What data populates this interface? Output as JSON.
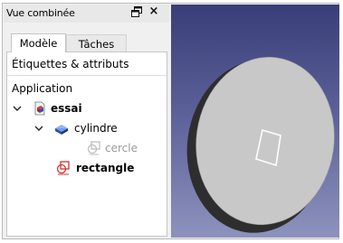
{
  "panel": {
    "title": "Vue combinée",
    "float_icon": "float-window-icon",
    "close_label": "×"
  },
  "tabs": [
    {
      "label": "Modèle",
      "active": true
    },
    {
      "label": "Tâches",
      "active": false
    }
  ],
  "tree": {
    "section_header": "Étiquettes & attributs",
    "group_label": "Application",
    "items": [
      {
        "label": "essai",
        "icon": "document-icon",
        "bold": true,
        "expanded": true
      },
      {
        "label": "cylindre",
        "icon": "cylinder-icon",
        "bold": false,
        "expanded": true
      },
      {
        "label": "cercle",
        "icon": "sketch-icon",
        "bold": false,
        "dim": true
      },
      {
        "label": "rectangle",
        "icon": "sketch-icon",
        "bold": true
      }
    ]
  },
  "colors": {
    "view_top": "#3a3e78",
    "view_bottom": "#8d92bd",
    "disk_face": "#c8c8c8",
    "disk_edge": "#2e2e2e"
  }
}
